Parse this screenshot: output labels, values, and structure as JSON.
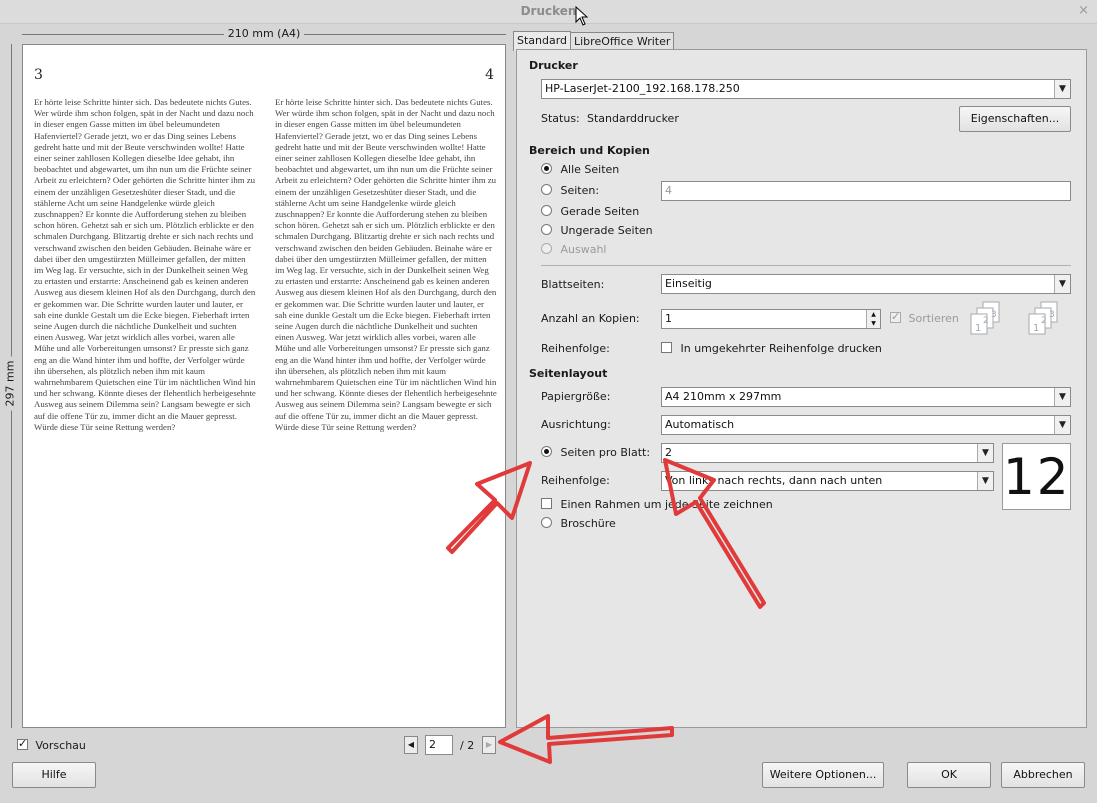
{
  "window": {
    "title": "Drucken",
    "close": "×"
  },
  "preview": {
    "ruler_width": "210 mm (A4)",
    "ruler_height": "297 mm",
    "page_left_number": "3",
    "page_right_number": "4",
    "page_left_text": "Er hörte leise Schritte hinter sich. Das bedeutete nichts Gutes. Wer würde ihm schon folgen, spät in der Nacht und dazu noch in dieser engen Gasse mitten im übel beleumundeten Hafenviertel? Gerade jetzt, wo er das Ding seines Lebens gedreht hatte und mit der Beute verschwinden wollte! Hatte einer seiner zahllosen Kollegen dieselbe Idee gehabt, ihn beobachtet und abgewartet, um ihn nun um die Früchte seiner Arbeit zu erleichtern? Oder gehörten die Schritte hinter ihm zu einem der unzähligen Gesetzeshüter dieser Stadt, und die stählerne Acht um seine Handgelenke würde gleich zuschnappen? Er konnte die Aufforderung stehen zu bleiben schon hören. Gehetzt sah er sich um. Plötzlich erblickte er den schmalen Durchgang. Blitzartig drehte er sich nach rechts und verschwand zwischen den beiden Gebäuden. Beinahe wäre er dabei über den umgestürzten Mülleimer gefallen, der mitten im Weg lag. Er versuchte, sich in der Dunkelheit seinen Weg zu ertasten und erstarrte: Anscheinend gab es keinen anderen Ausweg aus diesem kleinen Hof als den Durchgang, durch den er gekommen war. Die Schritte wurden lauter und lauter, er sah eine dunkle Gestalt um die Ecke biegen. Fieberhaft irrten seine Augen durch die nächtliche Dunkelheit und suchten einen Ausweg. War jetzt wirklich alles vorbei, waren alle Mühe und alle Vorbereitungen umsonst? Er presste sich ganz eng an die Wand hinter ihm und hoffte, der Verfolger würde ihn übersehen, als plötzlich neben ihm mit kaum wahrnehmbarem Quietschen eine Tür im nächtlichen Wind hin und her schwang. Könnte dieses der flehentlich herbeigesehnte Ausweg aus seinem Dilemma sein? Langsam bewegte er sich auf die offene Tür zu, immer dicht an die Mauer gepresst. Würde diese Tür seine Rettung werden?",
    "page_right_text": "Er hörte leise Schritte hinter sich. Das bedeutete nichts Gutes. Wer würde ihm schon folgen, spät in der Nacht und dazu noch in dieser engen Gasse mitten im übel beleumundeten Hafenviertel? Gerade jetzt, wo er das Ding seines Lebens gedreht hatte und mit der Beute verschwinden wollte! Hatte einer seiner zahllosen Kollegen dieselbe Idee gehabt, ihn beobachtet und abgewartet, um ihn nun um die Früchte seiner Arbeit zu erleichtern? Oder gehörten die Schritte hinter ihm zu einem der unzähligen Gesetzeshüter dieser Stadt, und die stählerne Acht um seine Handgelenke würde gleich zuschnappen? Er konnte die Aufforderung stehen zu bleiben schon hören. Gehetzt sah er sich um. Plötzlich erblickte er den schmalen Durchgang. Blitzartig drehte er sich nach rechts und verschwand zwischen den beiden Gebäuden. Beinahe wäre er dabei über den umgestürzten Mülleimer gefallen, der mitten im Weg lag. Er versuchte, sich in der Dunkelheit seinen Weg zu ertasten und erstarrte: Anscheinend gab es keinen anderen Ausweg aus diesem kleinen Hof als den Durchgang, durch den er gekommen war. Die Schritte wurden lauter und lauter, er sah eine dunkle Gestalt um die Ecke biegen. Fieberhaft irrten seine Augen durch die nächtliche Dunkelheit und suchten einen Ausweg. War jetzt wirklich alles vorbei, waren alle Mühe und alle Vorbereitungen umsonst? Er presste sich ganz eng an die Wand hinter ihm und hoffte, der Verfolger würde ihn übersehen, als plötzlich neben ihm mit kaum wahrnehmbarem Quietschen eine Tür im nächtlichen Wind hin und her schwang. Könnte dieses der flehentlich herbeigesehnte Ausweg aus seinem Dilemma sein? Langsam bewegte er sich auf die offene Tür zu, immer dicht an die Mauer gepresst. Würde diese Tür seine Rettung werden?",
    "show_preview_label": "Vorschau",
    "page_current": "2",
    "page_total": "/ 2"
  },
  "tabs": [
    {
      "label": "Standard"
    },
    {
      "label": "LibreOffice Writer"
    }
  ],
  "printer": {
    "heading": "Drucker",
    "selected": "HP-LaserJet-2100_192.168.178.250",
    "status_label": "Status:",
    "status_value": "Standarddrucker",
    "properties_button": "Eigenschaften..."
  },
  "range": {
    "heading": "Bereich und Kopien",
    "all_pages": "Alle Seiten",
    "pages": "Seiten:",
    "pages_value": "4",
    "even_pages": "Gerade Seiten",
    "odd_pages": "Ungerade Seiten",
    "selection": "Auswahl",
    "sides_label": "Blattseiten:",
    "sides_value": "Einseitig",
    "copies_label": "Anzahl an Kopien:",
    "copies_value": "1",
    "collate_label": "Sortieren",
    "order_label": "Reihenfolge:",
    "reverse_label": "In umgekehrter Reihenfolge drucken"
  },
  "layout": {
    "heading": "Seitenlayout",
    "paper_label": "Papiergröße:",
    "paper_value": "A4 210mm x 297mm",
    "orientation_label": "Ausrichtung:",
    "orientation_value": "Automatisch",
    "pps_label": "Seiten pro Blatt:",
    "pps_value": "2",
    "order_label": "Reihenfolge:",
    "order_value": "Von links nach rechts, dann nach unten",
    "border_label": "Einen Rahmen um jede Seite zeichnen",
    "brochure_label": "Broschüre",
    "preview_digits": "12"
  },
  "buttons": {
    "help": "Hilfe",
    "more_options": "Weitere Optionen...",
    "ok": "OK",
    "cancel": "Abbrechen"
  },
  "colors": {
    "annotation_arrow": "#e03a3a"
  }
}
